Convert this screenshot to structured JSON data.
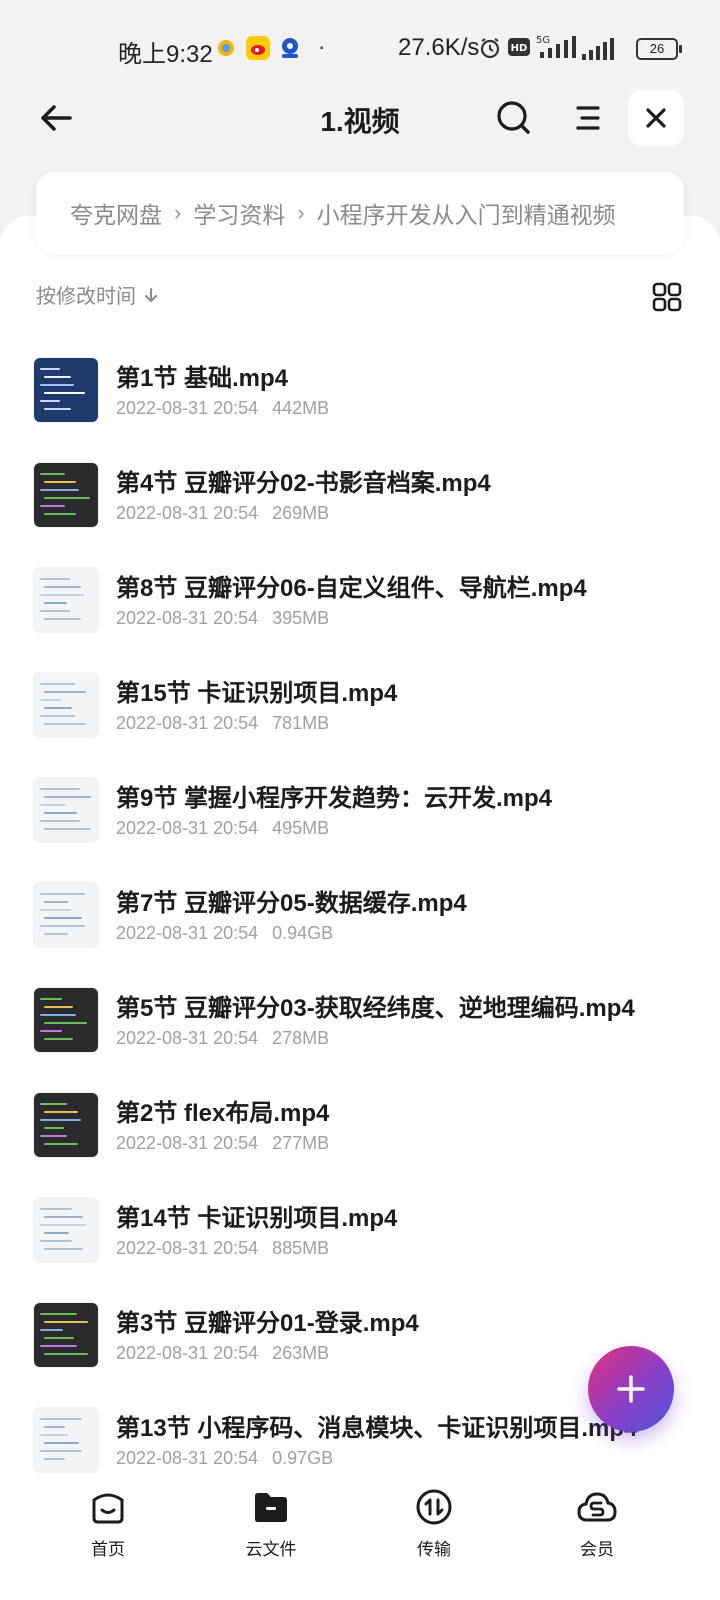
{
  "status_bar": {
    "time": "晚上9:32",
    "dot": "·",
    "net_speed": "27.6K/s",
    "battery": "26"
  },
  "header": {
    "title": "1.视频"
  },
  "breadcrumb": {
    "items": [
      "夸克网盘",
      "学习资料",
      "小程序开发从入门到精通视频"
    ]
  },
  "sort": {
    "label": "按修改时间"
  },
  "files": [
    {
      "name": "第1节 基础.mp4",
      "date": "2022-08-31 20:54",
      "size": "442MB",
      "thumb": "blue"
    },
    {
      "name": "第4节 豆瓣评分02-书影音档案.mp4",
      "date": "2022-08-31 20:54",
      "size": "269MB",
      "thumb": "dark"
    },
    {
      "name": "第8节 豆瓣评分06-自定义组件、导航栏.mp4",
      "date": "2022-08-31 20:54",
      "size": "395MB",
      "thumb": "light"
    },
    {
      "name": "第15节  卡证识别项目.mp4",
      "date": "2022-08-31 20:54",
      "size": "781MB",
      "thumb": "light"
    },
    {
      "name": "第9节 掌握小程序开发趋势：云开发.mp4",
      "date": "2022-08-31 20:54",
      "size": "495MB",
      "thumb": "light"
    },
    {
      "name": "第7节 豆瓣评分05-数据缓存.mp4",
      "date": "2022-08-31 20:54",
      "size": "0.94GB",
      "thumb": "light"
    },
    {
      "name": "第5节 豆瓣评分03-获取经纬度、逆地理编码.mp4",
      "date": "2022-08-31 20:54",
      "size": "278MB",
      "thumb": "dark"
    },
    {
      "name": "第2节 flex布局.mp4",
      "date": "2022-08-31 20:54",
      "size": "277MB",
      "thumb": "dark"
    },
    {
      "name": "第14节 卡证识别项目.mp4",
      "date": "2022-08-31 20:54",
      "size": "885MB",
      "thumb": "light"
    },
    {
      "name": "第3节 豆瓣评分01-登录.mp4",
      "date": "2022-08-31 20:54",
      "size": "263MB",
      "thumb": "dark"
    },
    {
      "name": "第13节 小程序码、消息模块、卡证识别项目.mp4",
      "date": "2022-08-31 20:54",
      "size": "0.97GB",
      "thumb": "light"
    }
  ],
  "bottom_nav": {
    "home": "首页",
    "cloud_files": "云文件",
    "transfer": "传输",
    "vip": "会员"
  },
  "colors": {
    "accent_gradient": [
      "#e0307a",
      "#8a3fc8",
      "#4a57d8"
    ],
    "text_primary": "#1c1c1e",
    "text_secondary": "#a0a0a5"
  }
}
